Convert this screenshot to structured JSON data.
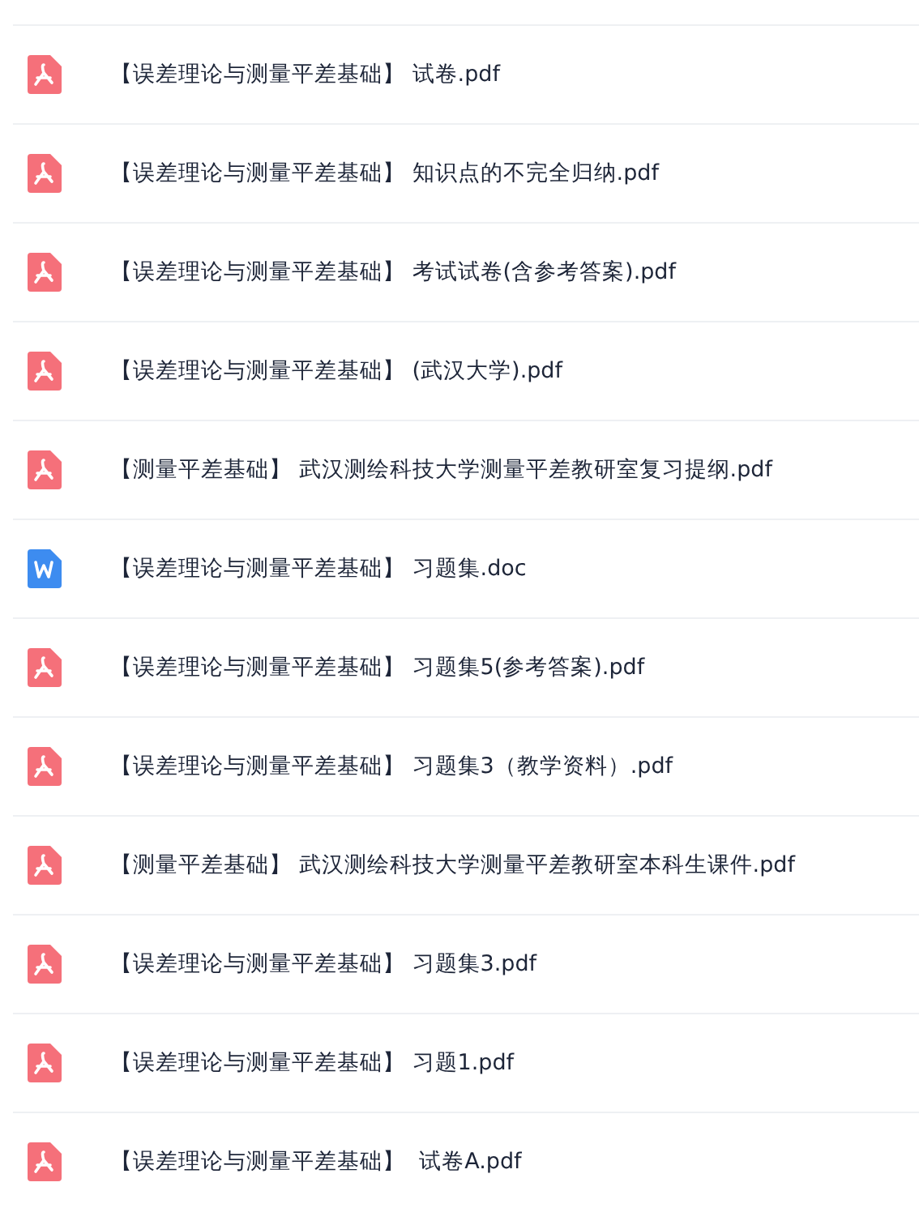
{
  "files": [
    {
      "kind": "pdf",
      "name": "【误差理论与测量平差基础】 试卷.pdf"
    },
    {
      "kind": "pdf",
      "name": "【误差理论与测量平差基础】 知识点的不完全归纳.pdf"
    },
    {
      "kind": "pdf",
      "name": "【误差理论与测量平差基础】 考试试卷(含参考答案).pdf"
    },
    {
      "kind": "pdf",
      "name": "【误差理论与测量平差基础】 (武汉大学).pdf"
    },
    {
      "kind": "pdf",
      "name": "【测量平差基础】 武汉测绘科技大学测量平差教研室复习提纲.pdf"
    },
    {
      "kind": "doc",
      "name": "【误差理论与测量平差基础】 习题集.doc"
    },
    {
      "kind": "pdf",
      "name": "【误差理论与测量平差基础】 习题集5(参考答案).pdf"
    },
    {
      "kind": "pdf",
      "name": "【误差理论与测量平差基础】 习题集3（教学资料）.pdf"
    },
    {
      "kind": "pdf",
      "name": "【测量平差基础】 武汉测绘科技大学测量平差教研室本科生课件.pdf"
    },
    {
      "kind": "pdf",
      "name": "【误差理论与测量平差基础】 习题集3.pdf"
    },
    {
      "kind": "pdf",
      "name": "【误差理论与测量平差基础】 习题1.pdf"
    },
    {
      "kind": "pdf",
      "name": "【误差理论与测量平差基础】  试卷A.pdf"
    }
  ]
}
